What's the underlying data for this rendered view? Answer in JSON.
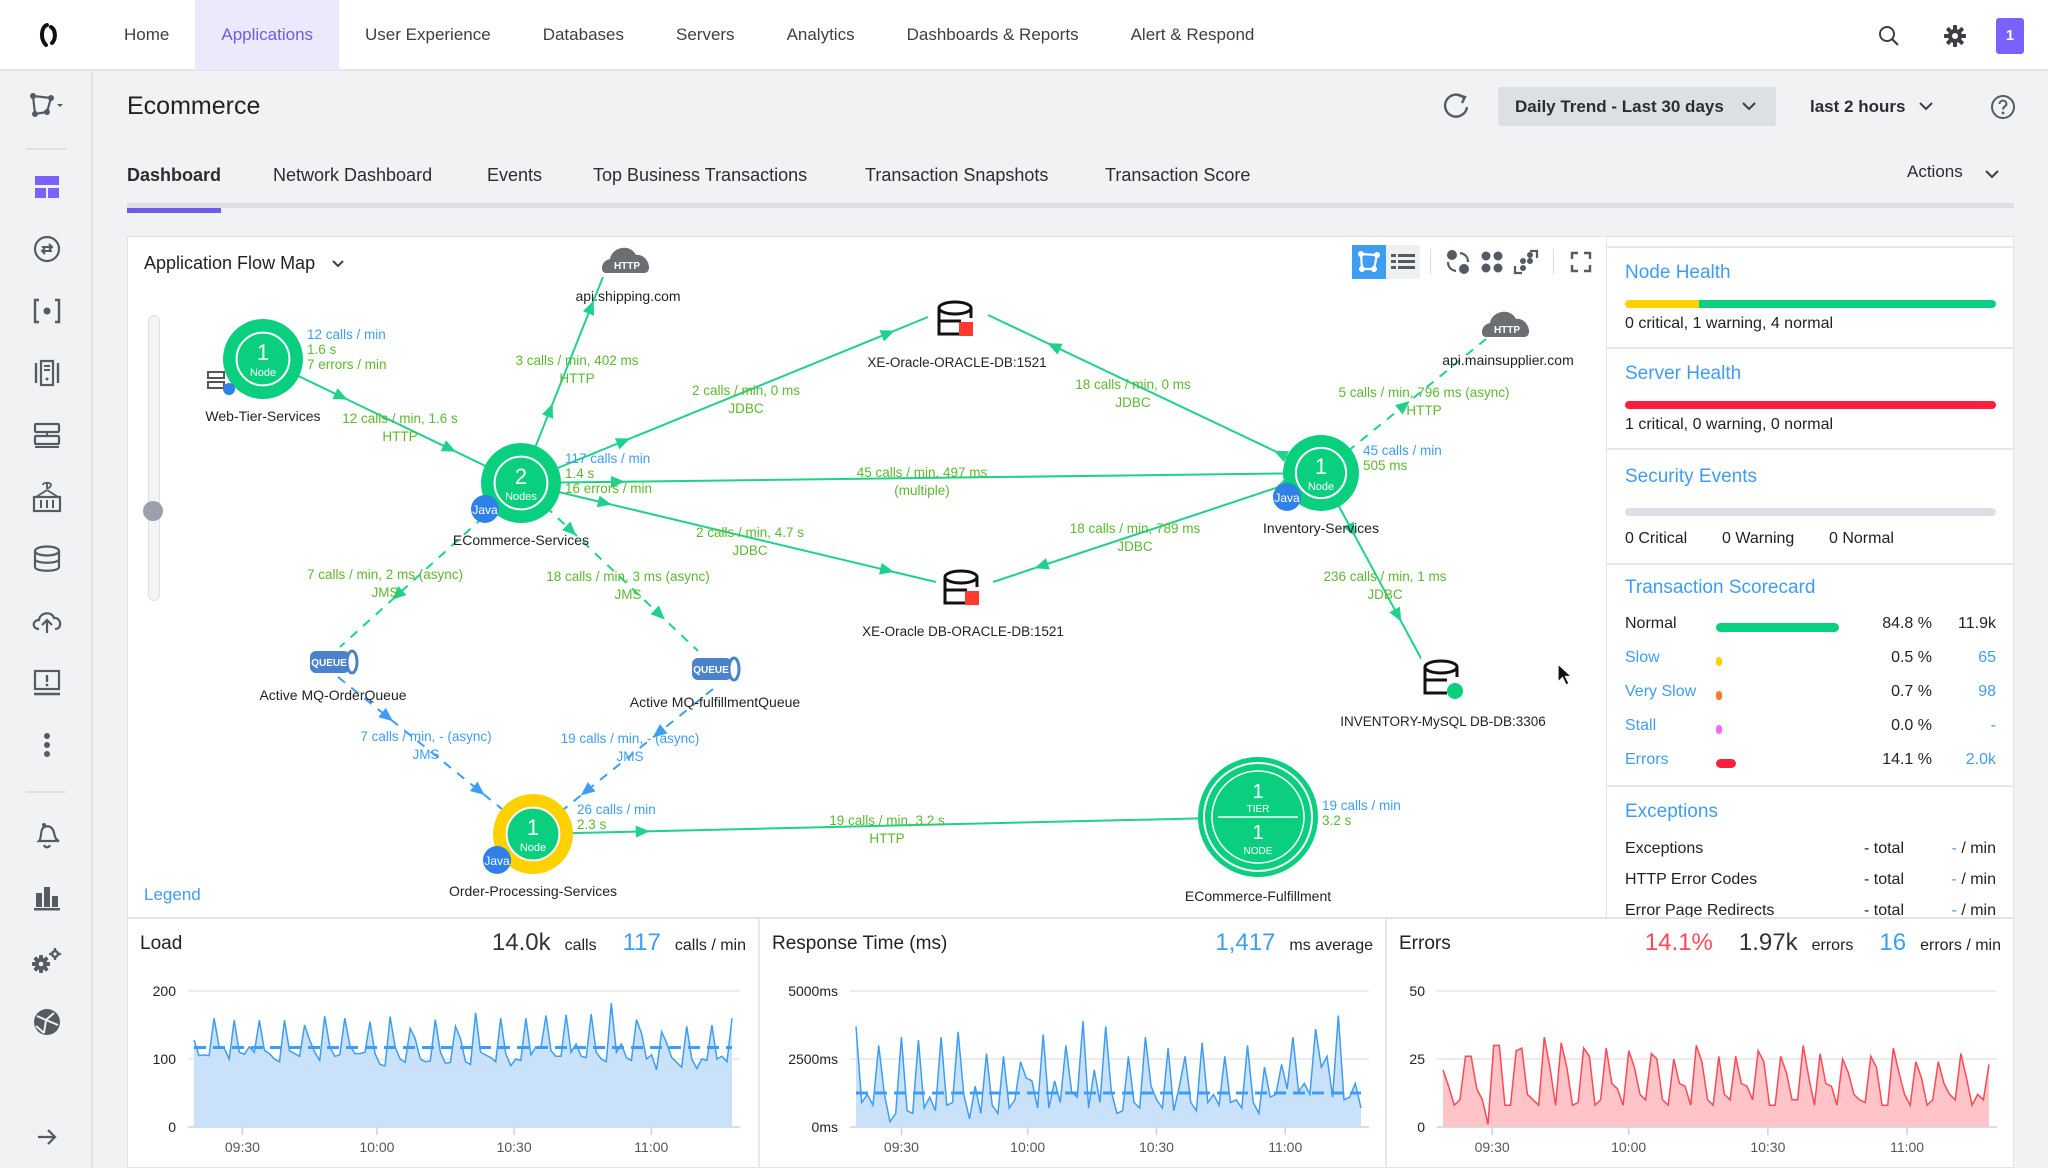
{
  "topnav": {
    "items": [
      {
        "label": "Home",
        "active": false
      },
      {
        "label": "Applications",
        "active": true
      },
      {
        "label": "User Experience",
        "active": false
      },
      {
        "label": "Databases",
        "active": false
      },
      {
        "label": "Servers",
        "active": false
      },
      {
        "label": "Analytics",
        "active": false
      },
      {
        "label": "Dashboards & Reports",
        "active": false
      },
      {
        "label": "Alert & Respond",
        "active": false
      }
    ],
    "user_badge": "1"
  },
  "sidebar": {
    "icons": [
      "flow-map-selector-icon",
      "dashboard-icon",
      "transactions-icon",
      "snapshots-icon",
      "tiers-icon",
      "servers-icon",
      "containers-icon",
      "databases-icon",
      "remote-services-icon",
      "troubleshoot-icon",
      "more-icon",
      "alerts-icon",
      "analytics-icon",
      "configuration-icon",
      "network-icon",
      "expand-icon"
    ]
  },
  "header": {
    "app_title": "Ecommerce",
    "baseline": "Daily Trend - Last 30 days",
    "time_range": "last 2 hours"
  },
  "tabs": [
    {
      "label": "Dashboard",
      "active": true
    },
    {
      "label": "Network Dashboard",
      "active": false
    },
    {
      "label": "Events",
      "active": false
    },
    {
      "label": "Top Business Transactions",
      "active": false
    },
    {
      "label": "Transaction Snapshots",
      "active": false
    },
    {
      "label": "Transaction Score",
      "active": false
    }
  ],
  "actions_label": "Actions",
  "flowmap": {
    "title": "Application Flow Map",
    "legend": "Legend",
    "colors": {
      "healthy": "#0acf7e",
      "warning": "#ffd100",
      "java": "#2f80e8",
      "edge": "#1fd18a",
      "edge_label": "#5cb82e",
      "edge_label_blue": "#3d9df3"
    },
    "tiers": {
      "web": {
        "name": "Web-Tier-Services",
        "count": "1",
        "unit": "Node",
        "calls": "12 calls / min",
        "time": "1.6 s",
        "errors": "7 errors / min"
      },
      "ecom": {
        "name": "ECommerce-Services",
        "count": "2",
        "unit": "Nodes",
        "badge": "Java",
        "calls": "117 calls / min",
        "time": "1.4 s",
        "errors": "16 errors / min"
      },
      "inv": {
        "name": "Inventory-Services",
        "count": "1",
        "unit": "Node",
        "badge": "Java",
        "calls": "45 calls / min",
        "time": "505 ms"
      },
      "order": {
        "name": "Order-Processing-Services",
        "count": "1",
        "unit": "Node",
        "badge": "Java",
        "calls": "26 calls / min",
        "time": "2.3 s"
      },
      "fulfill": {
        "name": "ECommerce-Fulfillment",
        "tier_count": "1",
        "tier_label": "TIER",
        "node_count": "1",
        "node_label": "NODE",
        "calls": "19 calls / min",
        "time": "3.2 s"
      }
    },
    "backends": {
      "shipping": {
        "name": "api.shipping.com",
        "badge": "HTTP"
      },
      "supplier": {
        "name": "api.mainsupplier.com",
        "badge": "HTTP"
      },
      "oracle1": {
        "name": "XE-Oracle-ORACLE-DB:1521"
      },
      "oracle2": {
        "name": "XE-Oracle DB-ORACLE-DB:1521"
      },
      "mysql": {
        "name": "INVENTORY-MySQL DB-DB:3306"
      },
      "orderq": {
        "name": "Active MQ-OrderQueue",
        "badge": "QUEUE"
      },
      "fulfillq": {
        "name": "Active MQ-fulfillmentQueue",
        "badge": "QUEUE"
      }
    },
    "edges": {
      "web_ecom": {
        "l1": "12 calls / min, 1.6 s",
        "l2": "HTTP"
      },
      "ecom_ship": {
        "l1": "3 calls / min, 402 ms",
        "l2": "HTTP"
      },
      "ecom_ora1": {
        "l1": "2 calls / min, 0 ms",
        "l2": "JDBC"
      },
      "inv_ora1": {
        "l1": "18 calls / min, 0 ms",
        "l2": "JDBC"
      },
      "ecom_inv": {
        "l1": "45 calls / min, 497 ms",
        "l2": "(multiple)"
      },
      "ecom_ora2": {
        "l1": "2 calls / min, 4.7 s",
        "l2": "JDBC"
      },
      "inv_ora2": {
        "l1": "18 calls / min, 789 ms",
        "l2": "JDBC"
      },
      "inv_sup": {
        "l1": "5 calls / min, 796 ms (async)",
        "l2": "HTTP"
      },
      "inv_mysql": {
        "l1": "236 calls / min, 1 ms",
        "l2": "JDBC"
      },
      "ecom_oq": {
        "l1": "7 calls / min, 2 ms (async)",
        "l2": "JMS"
      },
      "ecom_fq": {
        "l1": "18 calls / min, 3 ms (async)",
        "l2": "JMS"
      },
      "oq_order": {
        "l1": "7 calls / min, - (async)",
        "l2": "JMS"
      },
      "fq_order": {
        "l1": "19 calls / min, - (async)",
        "l2": "JMS"
      },
      "order_ful": {
        "l1": "19 calls / min, 3.2 s",
        "l2": "HTTP"
      }
    }
  },
  "right_panel": {
    "node_health": {
      "title": "Node Health",
      "summary": "0 critical, 1 warning, 4 normal",
      "critical": 0,
      "warning": 1,
      "normal": 4
    },
    "server_health": {
      "title": "Server Health",
      "summary": "1 critical, 0 warning, 0 normal",
      "critical": 1,
      "warning": 0,
      "normal": 0
    },
    "security": {
      "title": "Security Events",
      "critical": "0 Critical",
      "warning": "0 Warning",
      "normal": "0 Normal"
    },
    "scorecard": {
      "title": "Transaction Scorecard",
      "rows": [
        {
          "label": "Normal",
          "pct": "84.8 %",
          "count": "11.9k",
          "value": 84.8,
          "color": "#0acf7e",
          "link": false
        },
        {
          "label": "Slow",
          "pct": "0.5 %",
          "count": "65",
          "value": 0.5,
          "color": "#ffd100",
          "link": true
        },
        {
          "label": "Very Slow",
          "pct": "0.7 %",
          "count": "98",
          "value": 0.7,
          "color": "#ff7a2f",
          "link": true
        },
        {
          "label": "Stall",
          "pct": "0.0 %",
          "count": "-",
          "value": 0.0,
          "color": "#f36cf0",
          "link": true
        },
        {
          "label": "Errors",
          "pct": "14.1 %",
          "count": "2.0k",
          "value": 14.1,
          "color": "#ff1f3d",
          "link": true
        }
      ]
    },
    "exceptions": {
      "title": "Exceptions",
      "rows": [
        {
          "label": "Exceptions",
          "total": "- total",
          "per_min_value": "-",
          "per_min_unit": " / min"
        },
        {
          "label": "HTTP Error Codes",
          "total": "- total",
          "per_min_value": "-",
          "per_min_unit": " / min"
        },
        {
          "label": "Error Page Redirects",
          "total": "- total",
          "per_min_value": "-",
          "per_min_unit": " / min"
        }
      ]
    }
  },
  "charts": {
    "load": {
      "title": "Load",
      "total": "14.0k",
      "total_unit": "calls",
      "rate": "117",
      "rate_unit": "calls / min"
    },
    "response": {
      "title": "Response Time (ms)",
      "avg": "1,417",
      "avg_unit": "ms average"
    },
    "errors": {
      "title": "Errors",
      "pct": "14.1%",
      "total": "1.97k",
      "total_unit": "errors",
      "rate": "16",
      "rate_unit": "errors / min"
    }
  },
  "chart_data": [
    {
      "type": "area",
      "title": "Load",
      "xlabel": "",
      "ylabel": "calls / min",
      "x_ticks": [
        "09:30",
        "10:00",
        "10:30",
        "11:00"
      ],
      "y_ticks": [
        "0",
        "100",
        "200"
      ],
      "ylim": [
        0,
        200
      ],
      "baseline": 117,
      "color": "#3d9df3",
      "values": [
        128,
        105,
        106,
        105,
        160,
        118,
        116,
        100,
        157,
        110,
        107,
        118,
        110,
        157,
        113,
        108,
        100,
        96,
        157,
        112,
        108,
        104,
        150,
        128,
        110,
        98,
        163,
        118,
        104,
        106,
        160,
        120,
        108,
        108,
        110,
        155,
        108,
        92,
        90,
        162,
        118,
        100,
        95,
        145,
        130,
        100,
        96,
        97,
        158,
        110,
        94,
        95,
        148,
        130,
        96,
        92,
        168,
        110,
        106,
        102,
        96,
        160,
        108,
        90,
        100,
        98,
        160,
        106,
        118,
        116,
        164,
        112,
        104,
        104,
        165,
        110,
        122,
        104,
        102,
        166,
        110,
        100,
        96,
        182,
        110,
        122,
        102,
        98,
        158,
        138,
        100,
        106,
        84,
        140,
        124,
        102,
        95,
        88,
        148,
        100,
        86,
        100,
        98,
        150,
        100,
        104,
        96,
        160
      ]
    },
    {
      "type": "area",
      "title": "Response Time (ms)",
      "xlabel": "",
      "ylabel": "ms",
      "x_ticks": [
        "09:30",
        "10:00",
        "10:30",
        "11:00"
      ],
      "y_ticks": [
        "0ms",
        "2500ms",
        "5000ms"
      ],
      "ylim": [
        0,
        5000
      ],
      "baseline": 1250,
      "color": "#3d9df3",
      "values": [
        3700,
        900,
        1200,
        800,
        3000,
        1200,
        200,
        500,
        3300,
        600,
        500,
        3200,
        700,
        1100,
        600,
        3300,
        800,
        900,
        3500,
        1200,
        300,
        1500,
        500,
        2700,
        800,
        500,
        2600,
        700,
        1000,
        2400,
        1800,
        1700,
        700,
        3400,
        700,
        1700,
        900,
        3000,
        1300,
        1100,
        3900,
        700,
        2100,
        900,
        3700,
        1300,
        500,
        600,
        2600,
        900,
        700,
        3300,
        1500,
        1000,
        700,
        2900,
        600,
        1500,
        2600,
        900,
        600,
        3100,
        900,
        1200,
        800,
        2600,
        900,
        1000,
        700,
        3000,
        900,
        500,
        2200,
        1100,
        1200,
        2300,
        1400,
        3300,
        1300,
        1600,
        1200,
        3600,
        2200,
        2600,
        1100,
        4100,
        1000,
        1100,
        1600,
        700
      ]
    },
    {
      "type": "area",
      "title": "Errors",
      "xlabel": "",
      "ylabel": "errors / min",
      "x_ticks": [
        "09:30",
        "10:00",
        "10:30",
        "11:00"
      ],
      "y_ticks": [
        "0",
        "25",
        "50"
      ],
      "ylim": [
        0,
        50
      ],
      "color": "#ff4757",
      "values": [
        21,
        15,
        8,
        10,
        26,
        26,
        14,
        10,
        1,
        30,
        30,
        8,
        8,
        28,
        29,
        12,
        10,
        8,
        33,
        22,
        8,
        31,
        22,
        8,
        9,
        29,
        26,
        8,
        10,
        29,
        16,
        14,
        8,
        28,
        22,
        12,
        10,
        27,
        25,
        10,
        8,
        25,
        16,
        15,
        8,
        30,
        24,
        10,
        8,
        26,
        12,
        10,
        26,
        16,
        15,
        10,
        28,
        24,
        8,
        8,
        26,
        20,
        10,
        10,
        30,
        18,
        8,
        27,
        16,
        15,
        8,
        25,
        20,
        12,
        10,
        9,
        26,
        22,
        8,
        8,
        29,
        20,
        12,
        8,
        24,
        18,
        8,
        10,
        24,
        16,
        12,
        10,
        27,
        18,
        8,
        12,
        10,
        23
      ]
    }
  ]
}
